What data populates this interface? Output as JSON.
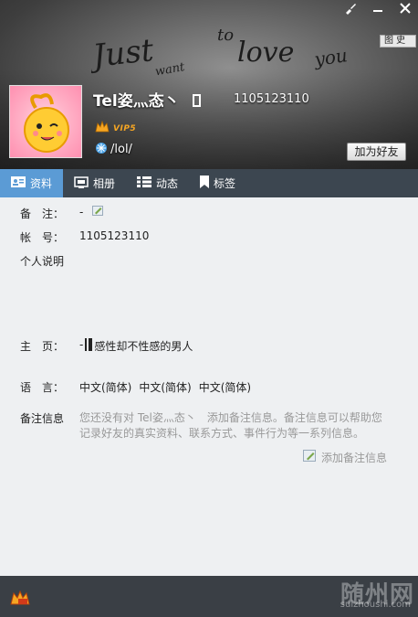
{
  "window": {
    "controls": {
      "skin": "skin-icon",
      "minimize": "minimize-icon",
      "close": "close-icon"
    }
  },
  "header": {
    "banner_text": [
      "Just",
      "to",
      "want",
      "love",
      "you"
    ],
    "nickname": "Tel姿灬态丶",
    "uin": "1105123110",
    "vip_label": "VIP5",
    "signature": "/lol/",
    "add_friend_label": "加为好友"
  },
  "tabs": [
    {
      "label": "资料",
      "icon": "profile-card-icon",
      "active": true
    },
    {
      "label": "相册",
      "icon": "photo-album-icon",
      "active": false
    },
    {
      "label": "动态",
      "icon": "feed-list-icon",
      "active": false
    },
    {
      "label": "标签",
      "icon": "bookmark-icon",
      "active": false
    }
  ],
  "profile": {
    "remark": {
      "label": "备　注：",
      "value": "-"
    },
    "account": {
      "label": "帐　号：",
      "value": "1105123110"
    },
    "bio": {
      "label": "个人说明"
    },
    "homepage": {
      "label": "主　页：",
      "prefix": "-",
      "value": "感性却不性感的男人"
    },
    "language": {
      "label": "语　言：",
      "values": [
        "中文(简体)",
        "中文(简体)",
        "中文(简体)"
      ]
    },
    "remark_info": {
      "label": "备注信息",
      "text": "您还没有对 Tel姿灬态丶　添加备注信息。备注信息可以帮助您记录好友的真实资料、联系方式、事件行为等一系列信息。",
      "add_link": "添加备注信息"
    }
  },
  "footer": {
    "watermark": "随州网",
    "watermark_url": "suizhoushi.com",
    "button_label": "图 史"
  },
  "colors": {
    "tab_active": "#5b9bd5",
    "tabbar_bg": "#3c4650",
    "vip_orange": "#f6a623"
  }
}
